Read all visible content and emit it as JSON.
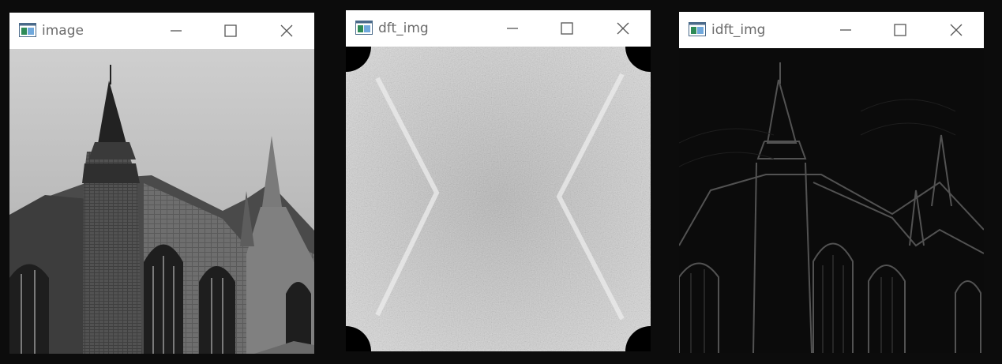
{
  "windows": [
    {
      "title": "image",
      "icon": "opencv-window-icon",
      "controls": [
        "minimize-icon",
        "maximize-icon",
        "close-icon"
      ]
    },
    {
      "title": "dft_img",
      "icon": "opencv-window-icon",
      "controls": [
        "minimize-icon",
        "maximize-icon",
        "close-icon"
      ]
    },
    {
      "title": "idft_img",
      "icon": "opencv-window-icon",
      "controls": [
        "minimize-icon",
        "maximize-icon",
        "close-icon"
      ]
    }
  ],
  "colors": {
    "desktop_bg": "#0c0c0c",
    "titlebar_bg": "#ffffff",
    "title_text": "#6b6b6b",
    "control_glyph": "#555555"
  }
}
